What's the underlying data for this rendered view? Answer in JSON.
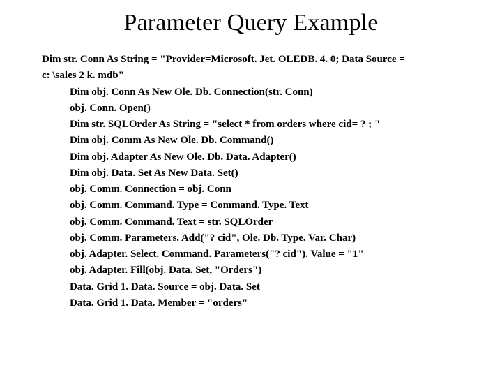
{
  "title": "Parameter Query Example",
  "code": {
    "wrapped_first_a": "Dim str. Conn As String = \"Provider=Microsoft. Jet. OLEDB. 4. 0; Data Source =",
    "wrapped_first_b": "c: \\sales 2 k. mdb\"",
    "lines": [
      "Dim obj. Conn As New Ole. Db. Connection(str. Conn)",
      "obj. Conn. Open()",
      "Dim str. SQLOrder As String = \"select * from orders where cid= ? ; \"",
      "Dim obj. Comm As New Ole. Db. Command()",
      "Dim obj. Adapter As New Ole. Db. Data. Adapter()",
      "Dim obj. Data. Set As New Data. Set()",
      "obj. Comm. Connection = obj. Conn",
      "obj. Comm. Command. Type = Command. Type. Text",
      "obj. Comm. Command. Text = str. SQLOrder",
      "obj. Comm. Parameters. Add(\"? cid\", Ole. Db. Type. Var. Char)",
      "obj. Adapter. Select. Command. Parameters(\"? cid\"). Value = \"1\"",
      "obj. Adapter. Fill(obj. Data. Set, \"Orders\")",
      "Data. Grid 1. Data. Source = obj. Data. Set",
      "Data. Grid 1. Data. Member = \"orders\""
    ]
  }
}
